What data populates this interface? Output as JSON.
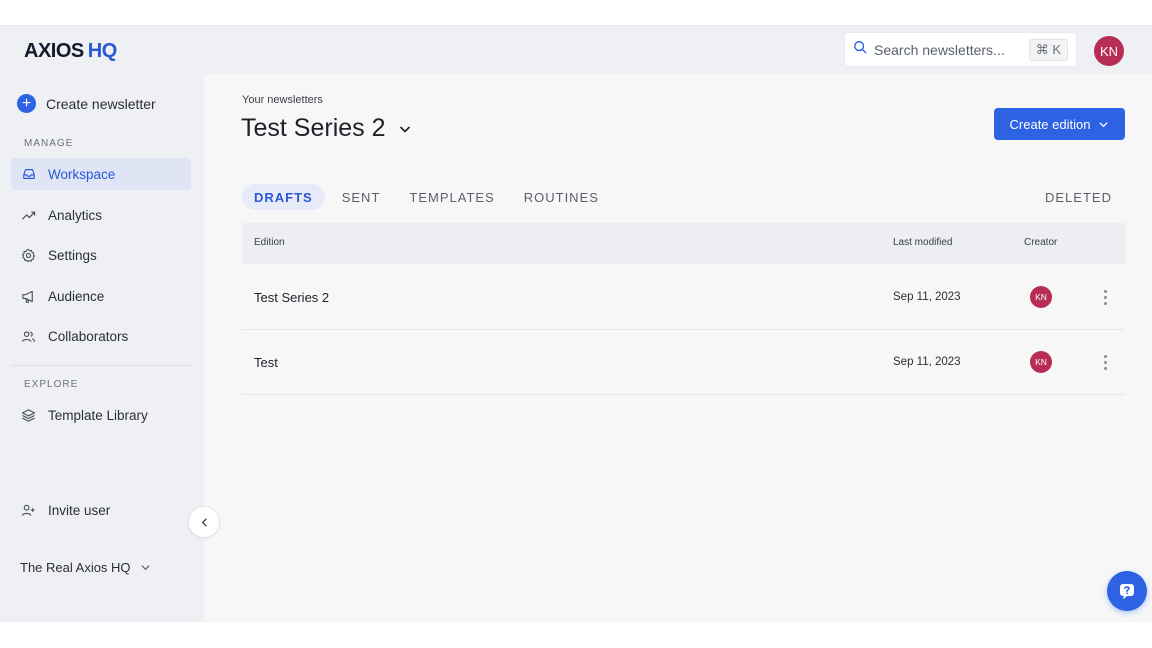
{
  "header": {
    "logo_main": "AXIOS",
    "logo_accent": "HQ",
    "search_placeholder": "Search newsletters...",
    "search_shortcut": "⌘ K",
    "user_initials": "KN"
  },
  "sidebar": {
    "create_label": "Create newsletter",
    "manage_label": "MANAGE",
    "items": [
      {
        "label": "Workspace",
        "icon": "inbox-icon",
        "active": true
      },
      {
        "label": "Analytics",
        "icon": "trend-icon"
      },
      {
        "label": "Settings",
        "icon": "gear-icon"
      },
      {
        "label": "Audience",
        "icon": "megaphone-icon"
      },
      {
        "label": "Collaborators",
        "icon": "users-icon"
      }
    ],
    "explore_label": "EXPLORE",
    "explore_items": [
      {
        "label": "Template Library",
        "icon": "layers-icon"
      }
    ],
    "invite_label": "Invite user",
    "org_name": "The Real Axios HQ"
  },
  "main": {
    "breadcrumb": "Your newsletters",
    "title": "Test Series 2",
    "create_edition_label": "Create edition",
    "tabs": [
      {
        "label": "DRAFTS",
        "active": true
      },
      {
        "label": "SENT"
      },
      {
        "label": "TEMPLATES"
      },
      {
        "label": "ROUTINES"
      }
    ],
    "deleted_tab": "DELETED",
    "table": {
      "columns": [
        "Edition",
        "Last modified",
        "Creator"
      ],
      "rows": [
        {
          "edition": "Test Series 2",
          "last_modified": "Sep 11, 2023",
          "creator": "KN"
        },
        {
          "edition": "Test",
          "last_modified": "Sep 11, 2023",
          "creator": "KN"
        }
      ]
    }
  },
  "colors": {
    "accent": "#2d62e3",
    "avatar": "#b72d56",
    "sidebar_bg": "#eef0f3"
  }
}
